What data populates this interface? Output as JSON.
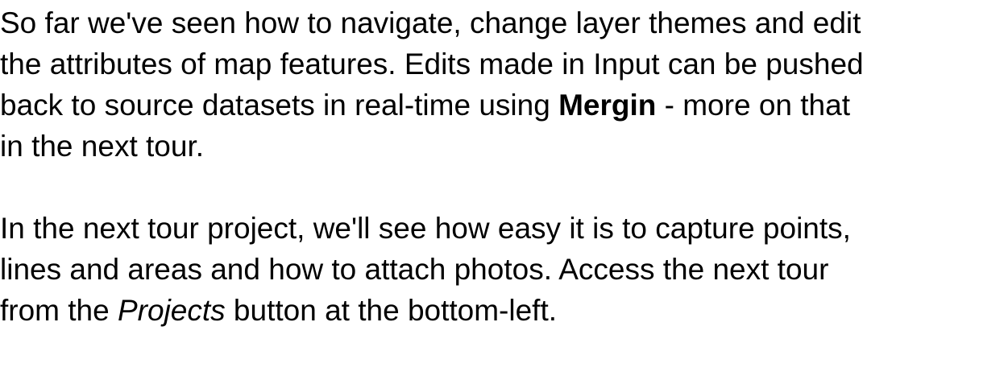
{
  "tour_text": {
    "paragraph_1": {
      "line_1": "So far we've seen how to navigate, change layer themes and edit",
      "line_2": "the attributes of map features. Edits made in Input can be pushed",
      "line_3_before": "back to source datasets in real-time using ",
      "line_3_bold": "Mergin",
      "line_3_after": " - more on that",
      "line_4": "in the next tour."
    },
    "paragraph_2": {
      "line_1": "In the next tour project, we'll see how easy it is to capture points,",
      "line_2": "lines and areas and how to attach photos. Access the next tour",
      "line_3_before": "from the ",
      "line_3_italic": "Projects",
      "line_3_after": " button at the bottom-left."
    }
  }
}
